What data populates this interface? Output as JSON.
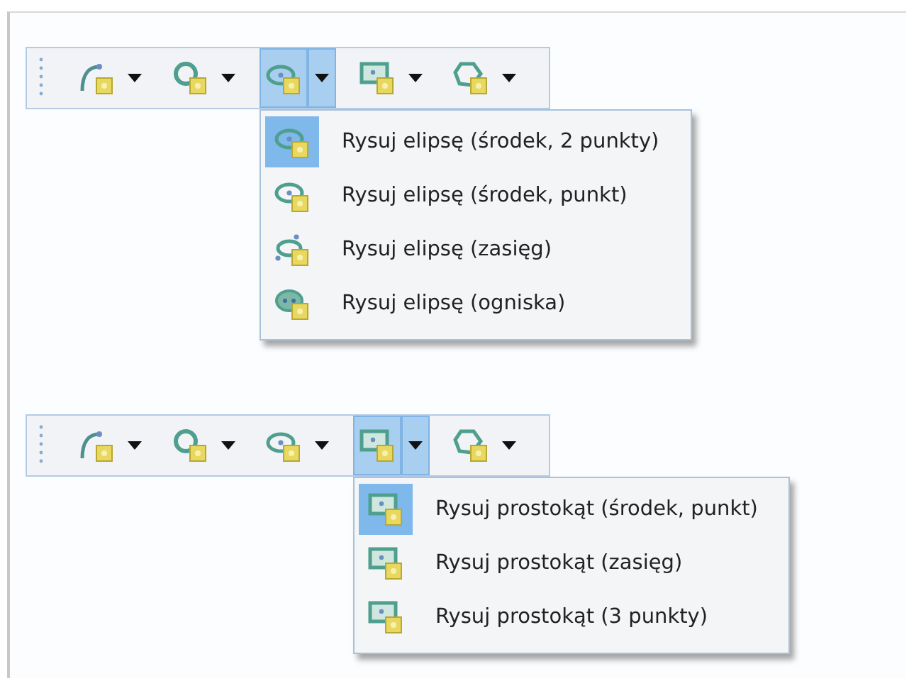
{
  "toolbars": [
    {
      "tools": [
        {
          "kind": "arc",
          "selected": false
        },
        {
          "kind": "circle",
          "selected": false
        },
        {
          "kind": "ellipse",
          "selected": true
        },
        {
          "kind": "rectangle",
          "selected": false
        },
        {
          "kind": "polygon",
          "selected": false
        }
      ],
      "menu": {
        "items": [
          {
            "kind": "ellipse",
            "label": "Rysuj elipsę (środek, 2 punkty)",
            "selected": true
          },
          {
            "kind": "ellipse",
            "label": "Rysuj elipsę (środek, punkt)",
            "selected": false
          },
          {
            "kind": "ellipse-extent",
            "label": "Rysuj elipsę (zasięg)",
            "selected": false
          },
          {
            "kind": "ellipse-foci",
            "label": "Rysuj elipsę (ogniska)",
            "selected": false
          }
        ]
      }
    },
    {
      "tools": [
        {
          "kind": "arc",
          "selected": false
        },
        {
          "kind": "circle",
          "selected": false
        },
        {
          "kind": "ellipse",
          "selected": false
        },
        {
          "kind": "rectangle",
          "selected": true
        },
        {
          "kind": "polygon",
          "selected": false
        }
      ],
      "menu": {
        "items": [
          {
            "kind": "rectangle",
            "label": "Rysuj prostokąt (środek, punkt)",
            "selected": true
          },
          {
            "kind": "rectangle",
            "label": "Rysuj prostokąt (zasięg)",
            "selected": false
          },
          {
            "kind": "rectangle",
            "label": "Rysuj prostokąt (3 punkty)",
            "selected": false
          }
        ]
      }
    }
  ]
}
